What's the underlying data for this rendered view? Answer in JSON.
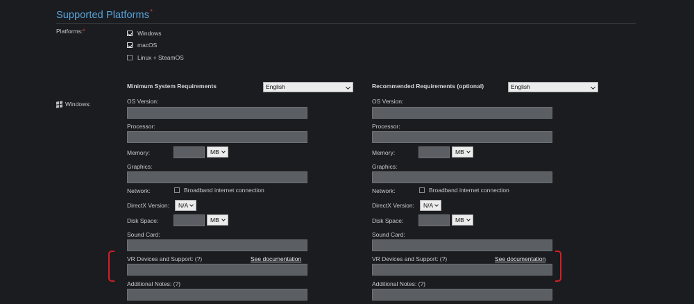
{
  "section": {
    "title": "Supported Platforms",
    "required_mark": "*"
  },
  "platforms": {
    "label": "Platforms:",
    "required_mark": "*",
    "options": [
      {
        "label": "Windows",
        "checked": true
      },
      {
        "label": "macOS",
        "checked": true
      },
      {
        "label": "Linux + SteamOS",
        "checked": false
      }
    ]
  },
  "windows_label": "Windows:",
  "windows_icon": "windows-logo-icon",
  "minimum": {
    "heading": "Minimum System Requirements",
    "language": "English",
    "os_label": "OS Version:",
    "processor_label": "Processor:",
    "memory_label": "Memory:",
    "memory_unit": "MB",
    "graphics_label": "Graphics:",
    "network_label": "Network:",
    "network_option": "Broadband internet connection",
    "directx_label": "DirectX Version:",
    "directx_value": "N/A",
    "disk_label": "Disk Space:",
    "disk_unit": "MB",
    "sound_label": "Sound Card:",
    "vr_label": "VR Devices and Support: (?)",
    "vr_link": "See documentation",
    "notes_label": "Additional Notes: (?)"
  },
  "recommended": {
    "heading": "Recommended Requirements (optional)",
    "language": "English",
    "os_label": "OS Version:",
    "processor_label": "Processor:",
    "memory_label": "Memory:",
    "memory_unit": "MB",
    "graphics_label": "Graphics:",
    "network_label": "Network:",
    "network_option": "Broadband internet connection",
    "directx_label": "DirectX Version:",
    "directx_value": "N/A",
    "disk_label": "Disk Space:",
    "disk_unit": "MB",
    "sound_label": "Sound Card:",
    "vr_label": "VR Devices and Support: (?)",
    "vr_link": "See documentation",
    "notes_label": "Additional Notes: (?)"
  },
  "colors": {
    "background": "#1b1c1f",
    "section_title": "#57a6e0",
    "required_mark": "#d93a3a",
    "input_fill": "#5b5e62",
    "highlight_bracket": "#d51f27"
  }
}
